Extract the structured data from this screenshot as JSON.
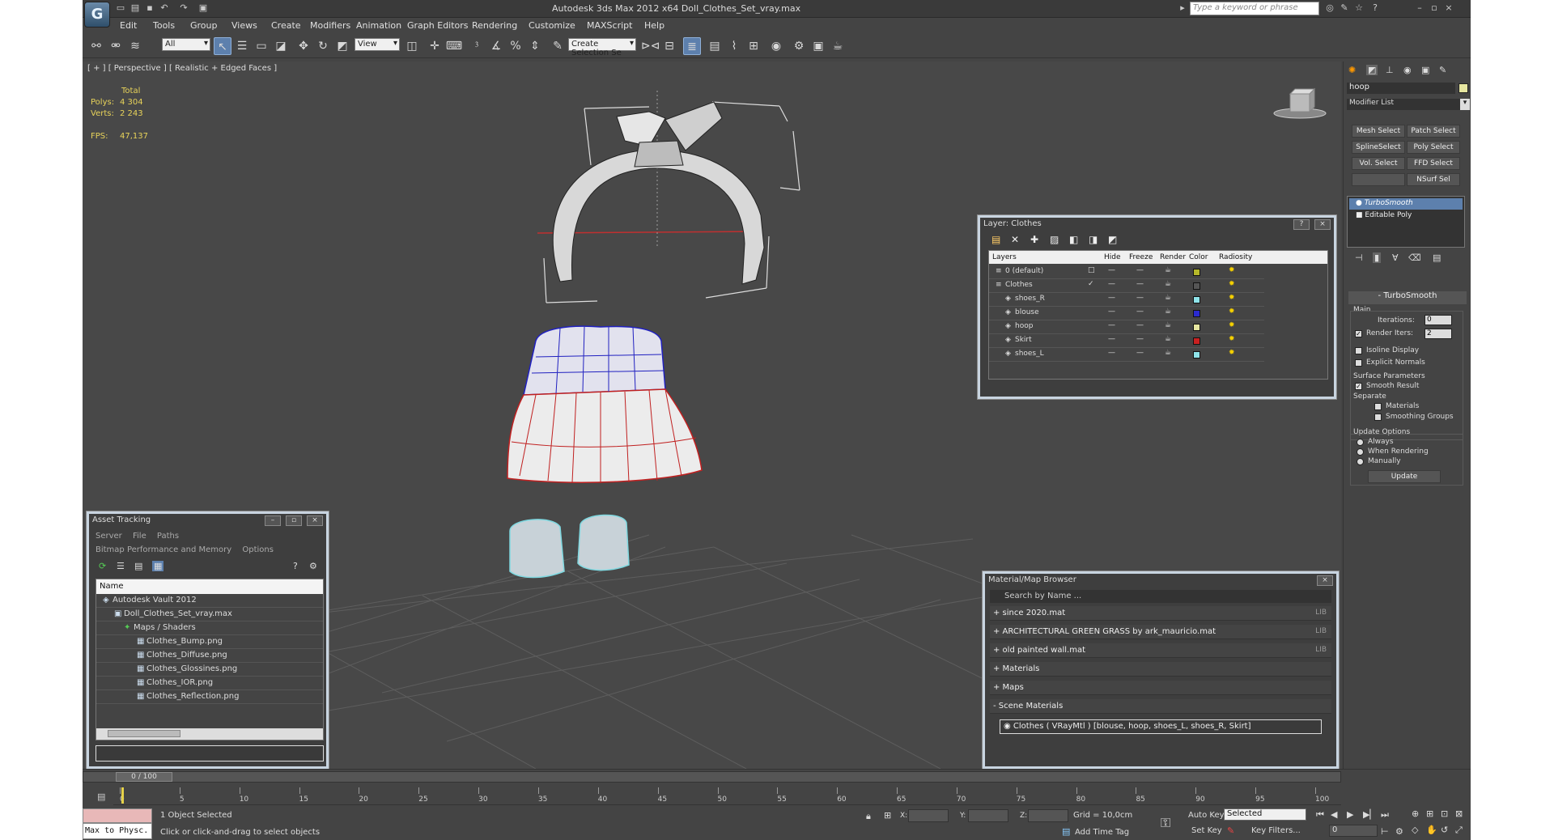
{
  "title": {
    "app_logo": "G",
    "text": "Autodesk 3ds Max  2012 x64      Doll_Clothes_Set_vray.max",
    "search_placeholder": "Type a keyword or phrase"
  },
  "menu": [
    "Edit",
    "Tools",
    "Group",
    "Views",
    "Create",
    "Modifiers",
    "Animation",
    "Graph Editors",
    "Rendering",
    "Customize",
    "MAXScript",
    "Help"
  ],
  "toolbar": {
    "selection_filter": "All",
    "ref_coord": "View",
    "named_selection": "Create Selection Se"
  },
  "viewport": {
    "label": "[ + ] [ Perspective ] [ Realistic + Edged Faces ]",
    "stats": {
      "total_label": "Total",
      "polys_label": "Polys:",
      "polys_value": "4 304",
      "verts_label": "Verts:",
      "verts_value": "2 243",
      "fps_label": "FPS:",
      "fps_value": "47,137"
    }
  },
  "layer_panel": {
    "title": "Layer: Clothes",
    "columns": [
      "Layers",
      "Hide",
      "Freeze",
      "Render",
      "Color",
      "Radiosity"
    ],
    "rows": [
      {
        "name": "0 (default)",
        "color": "#b5b82a",
        "mark": "□"
      },
      {
        "name": "Clothes",
        "color": "#555555",
        "mark": "✓"
      },
      {
        "name": "shoes_R",
        "color": "#8fe4ea",
        "mark": ""
      },
      {
        "name": "blouse",
        "color": "#2a2ad0",
        "mark": ""
      },
      {
        "name": "hoop",
        "color": "#e6e6a0",
        "mark": ""
      },
      {
        "name": "Skirt",
        "color": "#c82020",
        "mark": ""
      },
      {
        "name": "shoes_L",
        "color": "#8fe4ea",
        "mark": ""
      }
    ]
  },
  "asset_panel": {
    "title": "Asset Tracking",
    "menu1": [
      "Server",
      "File",
      "Paths"
    ],
    "menu2": [
      "Bitmap Performance and Memory",
      "Options"
    ],
    "column": "Name",
    "rows": [
      "Autodesk Vault 2012",
      "Doll_Clothes_Set_vray.max",
      "Maps / Shaders",
      "Clothes_Bump.png",
      "Clothes_Diffuse.png",
      "Clothes_Glossines.png",
      "Clothes_IOR.png",
      "Clothes_Reflection.png"
    ]
  },
  "material_panel": {
    "title": "Material/Map Browser",
    "search": "Search by Name ...",
    "rows": [
      {
        "text": "+ since 2020.mat",
        "tag": "LIB"
      },
      {
        "text": "+ ARCHITECTURAL GREEN GRASS by ark_mauricio.mat",
        "tag": "LIB"
      },
      {
        "text": "+ old painted wall.mat",
        "tag": "LIB"
      },
      {
        "text": "+ Materials",
        "tag": ""
      },
      {
        "text": "+ Maps",
        "tag": ""
      },
      {
        "text": "- Scene Materials",
        "tag": ""
      }
    ],
    "scene_item": "Clothes  ( VRayMtl )  [blouse, hoop, shoes_L, shoes_R, Skirt]"
  },
  "command_panel": {
    "object_name": "hoop",
    "modifier_list": "Modifier List",
    "mod_buttons": [
      "Mesh Select",
      "Patch Select",
      "SplineSelect",
      "Poly Select",
      "Vol. Select",
      "FFD Select",
      "",
      "NSurf Sel"
    ],
    "stack": [
      "TurboSmooth",
      "Editable Poly"
    ],
    "rollout_title": "TurboSmooth",
    "main_label": "Main",
    "iterations_label": "Iterations:",
    "iterations_value": "0",
    "render_iters_label": "Render Iters:",
    "render_iters_value": "2",
    "isoline": "Isoline Display",
    "explicit": "Explicit Normals",
    "surface_label": "Surface Parameters",
    "smooth_result": "Smooth Result",
    "separate_label": "Separate",
    "materials": "Materials",
    "smoothing_groups": "Smoothing Groups",
    "update_label": "Update Options",
    "always": "Always",
    "when_rendering": "When Rendering",
    "manually": "Manually",
    "update_button": "Update"
  },
  "timeline": {
    "frame": "0 / 100",
    "ticks": [
      "0",
      "5",
      "10",
      "15",
      "20",
      "25",
      "30",
      "35",
      "40",
      "45",
      "50",
      "55",
      "60",
      "65",
      "70",
      "75",
      "80",
      "85",
      "90",
      "95",
      "100"
    ]
  },
  "status": {
    "maxscript": "Max to Physc.",
    "selected": "1 Object Selected",
    "prompt": "Click or click-and-drag to select objects",
    "x_label": "X:",
    "y_label": "Y:",
    "z_label": "Z:",
    "grid": "Grid = 10,0cm",
    "add_time_tag": "Add Time Tag",
    "auto_key": "Auto Key",
    "auto_key_value": "Selected",
    "set_key": "Set Key",
    "key_filters": "Key Filters...",
    "frame_value": "0"
  }
}
